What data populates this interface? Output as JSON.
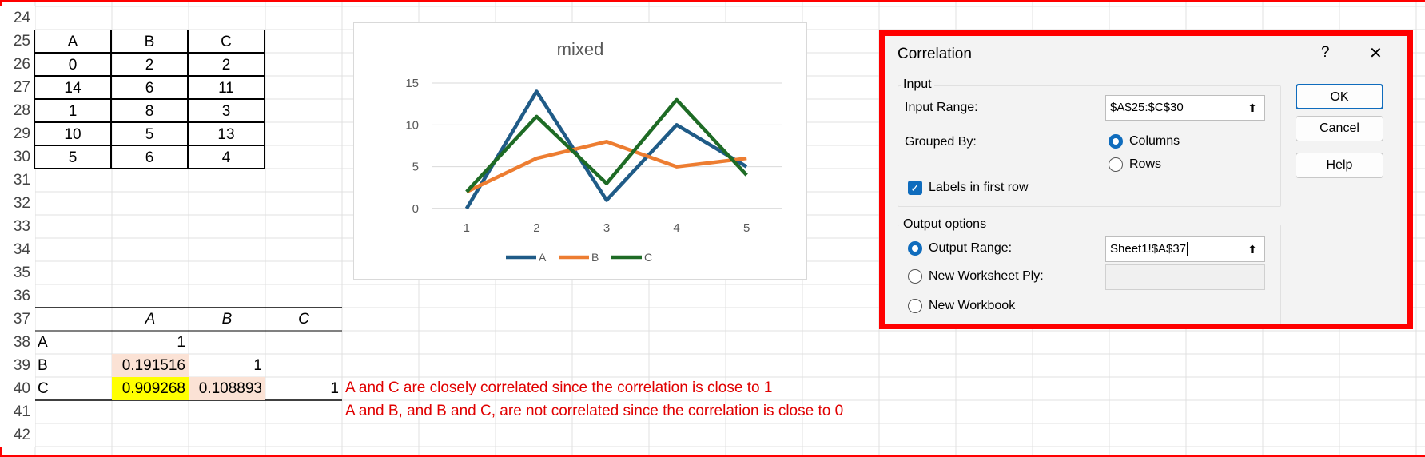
{
  "rows": [
    "24",
    "25",
    "26",
    "27",
    "28",
    "29",
    "30",
    "31",
    "32",
    "33",
    "34",
    "35",
    "36",
    "37",
    "38",
    "39",
    "40",
    "41",
    "42"
  ],
  "input_table": {
    "headers": [
      "A",
      "B",
      "C"
    ],
    "rows": [
      [
        "0",
        "2",
        "2"
      ],
      [
        "14",
        "6",
        "11"
      ],
      [
        "1",
        "8",
        "3"
      ],
      [
        "10",
        "5",
        "13"
      ],
      [
        "5",
        "6",
        "4"
      ]
    ]
  },
  "output_table": {
    "headers": [
      "A",
      "B",
      "C"
    ],
    "rows": [
      {
        "label": "A",
        "cells": [
          "1",
          "",
          ""
        ]
      },
      {
        "label": "B",
        "cells": [
          "0.191516",
          "1",
          ""
        ]
      },
      {
        "label": "C",
        "cells": [
          "0.909268",
          "0.108893",
          "1"
        ]
      }
    ]
  },
  "notes": [
    "A and C are closely correlated since the correlation is close to 1",
    "A and B, and B and C, are not correlated since the correlation is close to 0"
  ],
  "colors": {
    "highlight_yellow": "#ffff00",
    "highlight_peach": "#fbe2d5",
    "note_red": "#e00000",
    "dialog_frame_red": "#ff0000",
    "accent_blue": "#0f6cbd"
  },
  "chart_data": {
    "type": "line",
    "title": "mixed",
    "categories": [
      "1",
      "2",
      "3",
      "4",
      "5"
    ],
    "ylim": [
      0,
      15
    ],
    "yticks": [
      "0",
      "5",
      "10",
      "15"
    ],
    "grid": true,
    "legend": "bottom",
    "series": [
      {
        "name": "A",
        "values": [
          0,
          14,
          1,
          10,
          5
        ],
        "color": "#1f5b87"
      },
      {
        "name": "B",
        "values": [
          2,
          6,
          8,
          5,
          6
        ],
        "color": "#ed7d31"
      },
      {
        "name": "C",
        "values": [
          2,
          11,
          3,
          13,
          4
        ],
        "color": "#1e6b25"
      }
    ]
  },
  "dialog": {
    "title": "Correlation",
    "help_glyph": "?",
    "close_glyph": "✕",
    "input_group": "Input",
    "input_range_label": "Input Range:",
    "input_range_value": "$A$25:$C$30",
    "grouped_by_label": "Grouped By:",
    "columns_label": "Columns",
    "rows_label": "Rows",
    "labels_first_row": "Labels in first row",
    "output_group": "Output options",
    "output_range_label": "Output Range:",
    "output_range_value": "Sheet1!$A$37",
    "new_ply_label": "New Worksheet Ply:",
    "new_workbook_label": "New Workbook",
    "ok": "OK",
    "cancel": "Cancel",
    "help": "Help",
    "collapse_glyph": "⬆",
    "check_glyph": "✓"
  }
}
